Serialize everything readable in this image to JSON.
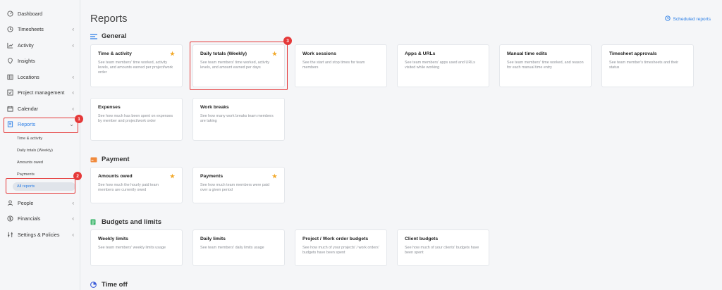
{
  "sidebar": {
    "items": [
      {
        "label": "Dashboard",
        "icon": "dashboard-icon",
        "chevron": ""
      },
      {
        "label": "Timesheets",
        "icon": "clock-icon",
        "chevron": "‹"
      },
      {
        "label": "Activity",
        "icon": "activity-icon",
        "chevron": "‹"
      },
      {
        "label": "Insights",
        "icon": "insights-icon",
        "chevron": ""
      },
      {
        "label": "Locations",
        "icon": "map-icon",
        "chevron": "‹"
      },
      {
        "label": "Project management",
        "icon": "checkbox-icon",
        "chevron": "‹"
      },
      {
        "label": "Calendar",
        "icon": "calendar-icon",
        "chevron": "‹"
      },
      {
        "label": "Reports",
        "icon": "reports-icon",
        "chevron": "⌄"
      }
    ],
    "reports_sub": [
      "Time & activity",
      "Daily totals (Weekly)",
      "Amounts owed",
      "Payments",
      "All reports"
    ],
    "bottom_items": [
      {
        "label": "People",
        "icon": "person-icon",
        "chevron": "‹"
      },
      {
        "label": "Financials",
        "icon": "dollar-icon",
        "chevron": "‹"
      },
      {
        "label": "Settings & Policies",
        "icon": "sliders-icon",
        "chevron": "‹"
      }
    ]
  },
  "header": {
    "title": "Reports",
    "scheduled_label": "Scheduled reports"
  },
  "badges": [
    "1",
    "2",
    "3"
  ],
  "sections": {
    "general": {
      "title": "General",
      "cards": [
        {
          "title": "Time & activity",
          "star": "★",
          "desc": "See team members' time worked, activity levels, and amounts earned per project/work order"
        },
        {
          "title": "Daily totals (Weekly)",
          "star": "★",
          "desc": "See team members' time worked, activity levels, and amount earned per days"
        },
        {
          "title": "Work sessions",
          "star": "",
          "desc": "See the start and stop times for team members"
        },
        {
          "title": "Apps & URLs",
          "star": "",
          "desc": "See team members' apps used and URLs visited while working"
        },
        {
          "title": "Manual time edits",
          "star": "",
          "desc": "See team members' time worked, and reason for each manual time entry"
        },
        {
          "title": "Timesheet approvals",
          "star": "",
          "desc": "See team member's timesheets and their status"
        },
        {
          "title": "Expenses",
          "star": "",
          "desc": "See how much has been spent on expenses by member and project/work order"
        },
        {
          "title": "Work breaks",
          "star": "",
          "desc": "See how many work breaks team members are taking"
        }
      ]
    },
    "payment": {
      "title": "Payment",
      "cards": [
        {
          "title": "Amounts owed",
          "star": "★",
          "desc": "See how much the hourly paid team members are currently owed"
        },
        {
          "title": "Payments",
          "star": "★",
          "desc": "See how much team members were paid over a given period"
        }
      ]
    },
    "budgets": {
      "title": "Budgets and limits",
      "cards": [
        {
          "title": "Weekly limits",
          "star": "",
          "desc": "See team members' weekly limits usage"
        },
        {
          "title": "Daily limits",
          "star": "",
          "desc": "See team members' daily limits usage"
        },
        {
          "title": "Project / Work order budgets",
          "star": "",
          "desc": "See how much of your projects' / work orders' budgets have been spent"
        },
        {
          "title": "Client budgets",
          "star": "",
          "desc": "See how much of your clients' budgets have been spent"
        }
      ]
    },
    "timeoff": {
      "title": "Time off"
    }
  },
  "colors": {
    "accent": "#2a7ee6",
    "highlight": "#e53939",
    "star": "#f2a92b",
    "general_icon": "#2a7ee6",
    "payment_icon": "#f08a3c",
    "budgets_icon": "#3bb56a",
    "timeoff_icon": "#3a5bd9"
  }
}
